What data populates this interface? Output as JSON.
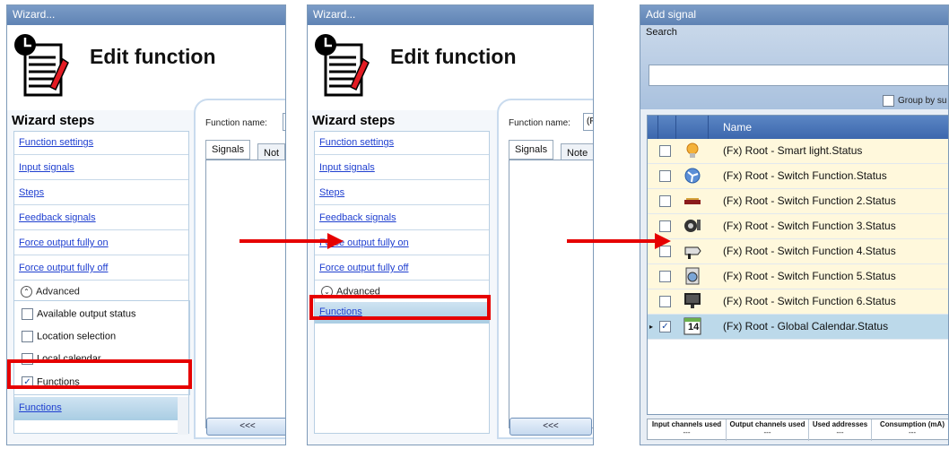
{
  "panel1": {
    "window_title": "Wizard...",
    "header_title": "Edit function",
    "steps_title": "Wizard steps",
    "steps": [
      "Function settings",
      "Input signals",
      "Steps",
      "Feedback signals",
      "Force output fully on",
      "Force output fully off"
    ],
    "advanced_label": "Advanced",
    "options": [
      {
        "label": "Available output status",
        "checked": false
      },
      {
        "label": "Location selection",
        "checked": false
      },
      {
        "label": "Local calendar",
        "checked": false
      },
      {
        "label": "Functions",
        "checked": true
      }
    ],
    "selected_step": "Functions",
    "function_name_label": "Function name:",
    "function_name_value": "",
    "tabs": [
      "Signals",
      "Not"
    ],
    "back_button": "<<<"
  },
  "panel2": {
    "window_title": "Wizard...",
    "header_title": "Edit function",
    "steps_title": "Wizard steps",
    "steps": [
      "Function settings",
      "Input signals",
      "Steps",
      "Feedback signals",
      "Force output fully on",
      "Force output fully off"
    ],
    "advanced_label": "Advanced",
    "selected_step": "Functions",
    "function_name_label": "Function name:",
    "function_name_value": "(F",
    "tabs": [
      "Signals",
      "Note"
    ],
    "back_button": "<<<"
  },
  "panel3": {
    "window_title": "Add signal",
    "search_label": "Search",
    "search_value": "",
    "group_by_label": "Group by su",
    "column_name": "Name",
    "rows": [
      {
        "icon": "light-bulb-icon",
        "name": "(Fx) Root - Smart light.Status",
        "checked": false
      },
      {
        "icon": "fan-icon",
        "name": "(Fx) Root - Switch Function.Status",
        "checked": false
      },
      {
        "icon": "heater-icon",
        "name": "(Fx) Root - Switch Function 2.Status",
        "checked": false
      },
      {
        "icon": "socket-icon",
        "name": "(Fx) Root - Switch Function 3.Status",
        "checked": false
      },
      {
        "icon": "hair-dryer-icon",
        "name": "(Fx) Root - Switch Function 4.Status",
        "checked": false
      },
      {
        "icon": "washing-machine-icon",
        "name": "(Fx) Root - Switch Function 5.Status",
        "checked": false
      },
      {
        "icon": "monitor-icon",
        "name": "(Fx) Root - Switch Function 6.Status",
        "checked": false
      },
      {
        "icon": "calendar-icon",
        "name": "(Fx) Root - Global Calendar.Status",
        "checked": true,
        "calendar_day": "14"
      }
    ],
    "footer_columns": [
      "Input channels used",
      "Output channels used",
      "Used addresses",
      "Consumption (mA)"
    ],
    "footer_values": [
      "---",
      "---",
      "---",
      "---"
    ]
  },
  "colors": {
    "titlebar": "#6a8ec0",
    "highlight": "#e60000",
    "link": "#1f3fd0",
    "grid_header": "#4a75b8",
    "selected_row": "#b9d7ea"
  }
}
